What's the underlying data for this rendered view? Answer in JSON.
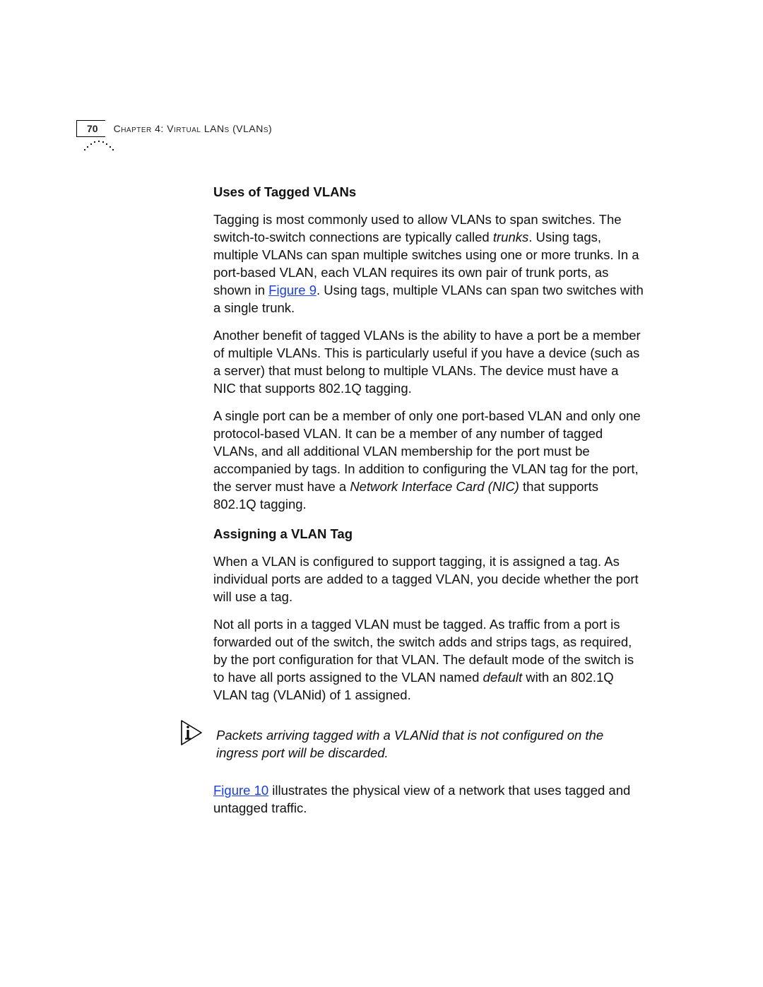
{
  "header": {
    "page_number": "70",
    "chapter_label": "Chapter 4: Virtual LANs (VLANs)"
  },
  "section1": {
    "heading": "Uses of Tagged VLANs",
    "p1a": "Tagging is most commonly used to allow VLANs to span switches. The switch-to-switch connections are typically called ",
    "p1_em1": "trunks",
    "p1b": ". Using tags, multiple VLANs can span multiple switches using one or more trunks. In a port-based VLAN, each VLAN requires its own pair of trunk ports, as shown in ",
    "p1_link": "Figure 9",
    "p1c": ". Using tags, multiple VLANs can span two switches with a single trunk.",
    "p2": "Another benefit of tagged VLANs is the ability to have a port be a member of multiple VLANs. This is particularly useful if you have a device (such as a server) that must belong to multiple VLANs. The device must have a NIC that supports 802.1Q tagging.",
    "p3a": "A single port can be a member of only one port-based VLAN and only one protocol-based VLAN. It can be a member of any number of tagged VLANs, and all additional VLAN membership for the port must be accompanied by tags. In addition to configuring the VLAN tag for the port, the server must have a ",
    "p3_em1": "Network Interface Card (NIC)",
    "p3b": " that supports 802.1Q tagging."
  },
  "section2": {
    "heading": "Assigning a VLAN Tag",
    "p1": "When a VLAN is configured to support tagging, it is assigned a tag. As individual ports are added to a tagged VLAN, you decide whether the port will use a tag.",
    "p2a": "Not all ports in a tagged VLAN must be tagged. As traffic from a port is forwarded out of the switch, the switch adds and strips tags, as required, by the port configuration for that VLAN. The default mode of the switch is to have all ports assigned to the VLAN named ",
    "p2_em1": "default",
    "p2b": " with an 802.1Q VLAN tag (VLANid) of 1 assigned.",
    "note": "Packets arriving tagged with a VLANid that is not configured on the ingress port will be discarded.",
    "p3_link": "Figure 10",
    "p3a": " illustrates the physical view of a network that uses tagged and untagged traffic."
  }
}
